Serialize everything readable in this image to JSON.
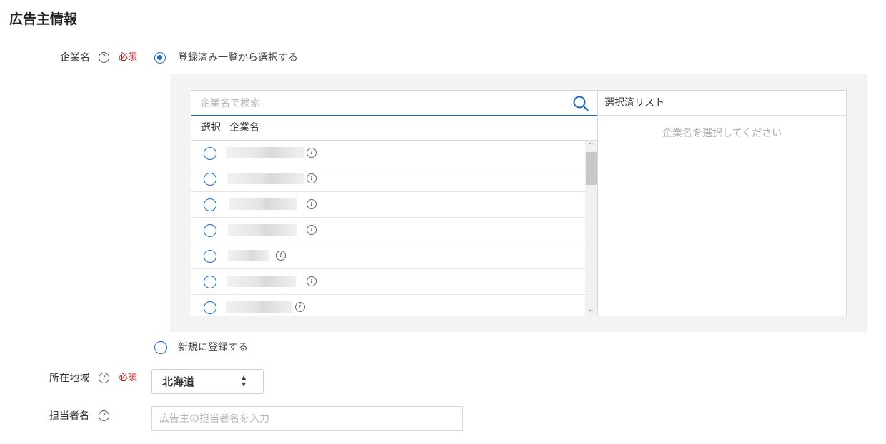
{
  "section": {
    "title": "広告主情報"
  },
  "company_field": {
    "label": "企業名",
    "help": "?",
    "required": "必須",
    "option_existing": "登録済み一覧から選択する",
    "option_new": "新規に登録する",
    "search_placeholder": "企業名で検索",
    "table_headers": {
      "select": "選択",
      "company": "企業名"
    },
    "selected_header": "選択済リスト",
    "selected_empty": "企業名を選択してください",
    "info_glyph": "i",
    "rows": [
      {
        "selected": false
      },
      {
        "selected": false
      },
      {
        "selected": false
      },
      {
        "selected": false
      },
      {
        "selected": false
      },
      {
        "selected": false
      },
      {
        "selected": false
      }
    ]
  },
  "region_field": {
    "label": "所在地域",
    "help": "?",
    "required": "必須",
    "value": "北海道",
    "arrows": "▲▼"
  },
  "contact_field": {
    "label": "担当者名",
    "help": "?",
    "placeholder": "広告主の担当者名を入力"
  },
  "colors": {
    "accent": "#1a6dc2",
    "required": "#c0171b",
    "panel": "#f3f3f3"
  },
  "icons": {
    "search": "search-icon",
    "info": "info-icon",
    "help": "help-icon",
    "select_arrows": "updown-arrows-icon"
  }
}
